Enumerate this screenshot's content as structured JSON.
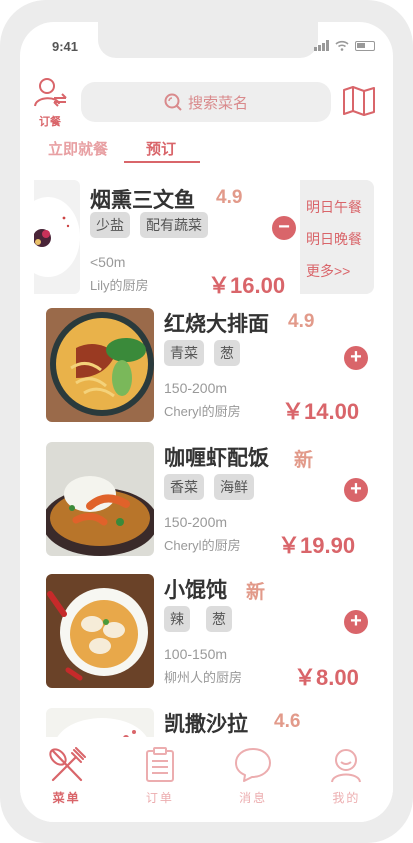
{
  "status_bar": {
    "time": "9:41"
  },
  "header": {
    "order_label": "订餐",
    "search_placeholder": "搜索菜名"
  },
  "tabs": [
    {
      "label": "立即就餐"
    },
    {
      "label": "预订"
    }
  ],
  "schedule_menu": {
    "items": [
      "明日午餐",
      "明日晚餐",
      "更多>>"
    ]
  },
  "dishes": [
    {
      "name": "烟熏三文鱼",
      "rating": "4.9",
      "tags": [
        "少盐",
        "配有蔬菜"
      ],
      "distance": "<50m",
      "kitchen": "Lily的厨房",
      "price": "￥16.00"
    },
    {
      "name": "红烧大排面",
      "rating": "4.9",
      "tags": [
        "青菜",
        "葱"
      ],
      "distance": "150-200m",
      "kitchen": "Cheryl的厨房",
      "price": "￥14.00"
    },
    {
      "name": "咖喱虾配饭",
      "rating": "新",
      "tags": [
        "香菜",
        "海鲜"
      ],
      "distance": "150-200m",
      "kitchen": "Cheryl的厨房",
      "price": "￥19.90"
    },
    {
      "name": "小馄饨",
      "rating": "新",
      "tags": [
        "辣",
        "葱"
      ],
      "distance": "100-150m",
      "kitchen": "柳州人的厨房",
      "price": "￥8.00"
    },
    {
      "name": "凯撒沙拉",
      "rating": "4.6"
    }
  ],
  "bottom_nav": [
    {
      "label": "菜单"
    },
    {
      "label": "订单"
    },
    {
      "label": "消息"
    },
    {
      "label": "我的"
    }
  ],
  "colors": {
    "accent": "#d9656a",
    "accent_light": "#ecadaf",
    "rating": "#e29a8a",
    "tag_bg": "#dcdcdc"
  }
}
